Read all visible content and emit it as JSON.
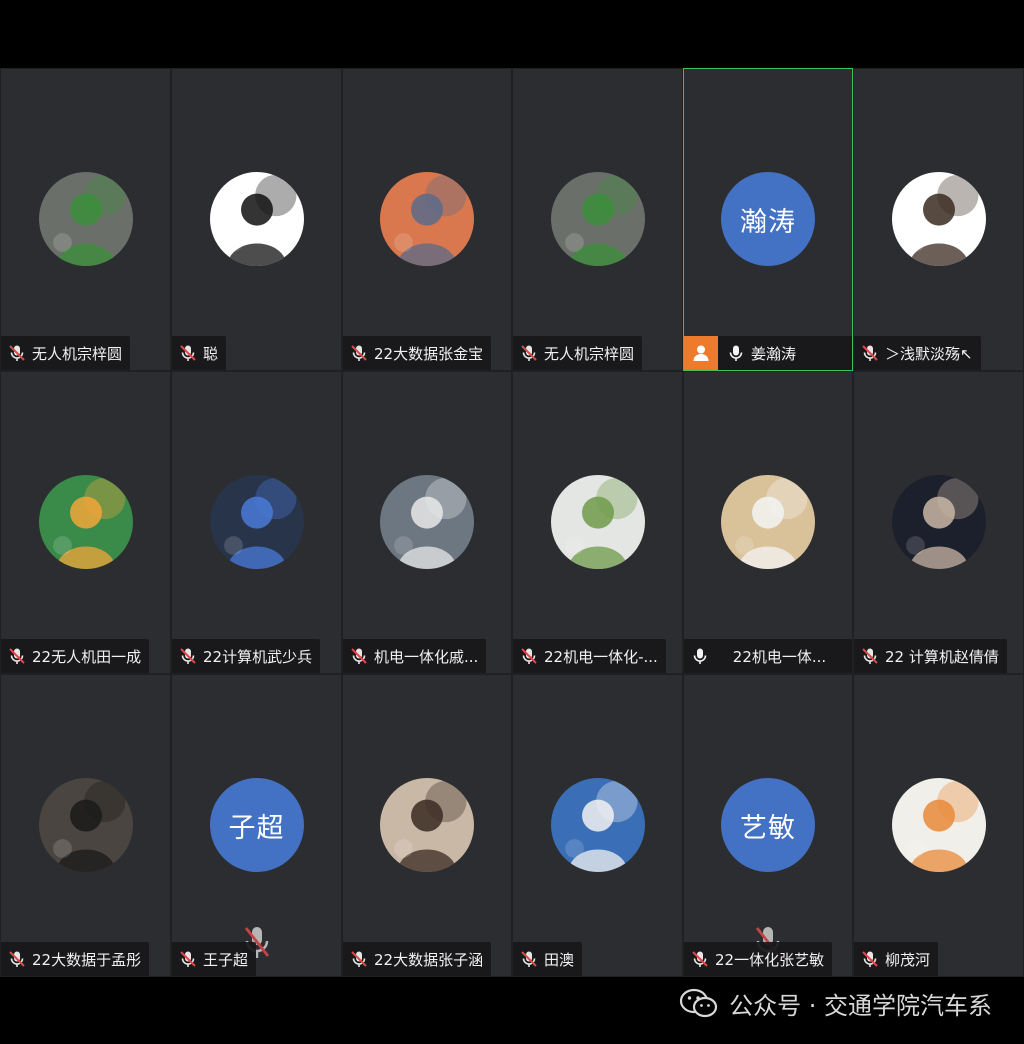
{
  "participants": [
    {
      "name": "无人机宗梓圆",
      "mic": "muted",
      "avatar": {
        "type": "image",
        "icon": "woman-photo-avatar",
        "bg": "#6b6f6a",
        "accent": "#3b8f3a"
      }
    },
    {
      "name": "聪",
      "mic": "muted",
      "avatar": {
        "type": "image",
        "icon": "sketch-avatar",
        "bg": "#ffffff",
        "accent": "#111111"
      }
    },
    {
      "name": "22大数据张金宝",
      "mic": "muted",
      "avatar": {
        "type": "image",
        "icon": "sunset-anime-avatar",
        "bg": "#d9784e",
        "accent": "#5a6a8a"
      }
    },
    {
      "name": "无人机宗梓圆",
      "mic": "muted",
      "avatar": {
        "type": "image",
        "icon": "woman-photo-avatar",
        "bg": "#6b6f6a",
        "accent": "#3b8f3a"
      }
    },
    {
      "name": "姜瀚涛",
      "mic": "on",
      "host": true,
      "active": true,
      "avatar": {
        "type": "text",
        "text": "瀚涛"
      }
    },
    {
      "name": "＞浅默淡殇↖",
      "mic": "muted",
      "avatar": {
        "type": "image",
        "icon": "cartoon-boy-avatar",
        "bg": "#ffffff",
        "accent": "#3a2a20"
      }
    },
    {
      "name": "22无人机田一成",
      "mic": "muted",
      "avatar": {
        "type": "image",
        "icon": "cartoon-robot-avatar",
        "bg": "#3a8a4a",
        "accent": "#f2a63a"
      }
    },
    {
      "name": "22计算机武少兵",
      "mic": "muted",
      "avatar": {
        "type": "image",
        "icon": "stitch-avatar",
        "bg": "#27344a",
        "accent": "#4a7ad8"
      }
    },
    {
      "name": "机电一体化戚...",
      "mic": "muted",
      "avatar": {
        "type": "image",
        "icon": "wave-art-avatar",
        "bg": "#6d7782",
        "accent": "#e8e8e8"
      }
    },
    {
      "name": "22机电一体化-...",
      "mic": "muted",
      "avatar": {
        "type": "image",
        "icon": "flower-photo-avatar",
        "bg": "#e4e6e3",
        "accent": "#6f9a4a"
      }
    },
    {
      "name": "22机电一体...",
      "mic": "on",
      "avatar": {
        "type": "image",
        "icon": "car-photo-avatar",
        "bg": "#d9c29a",
        "accent": "#f3f3f3"
      }
    },
    {
      "name": "22 计算机赵倩倩",
      "mic": "muted",
      "avatar": {
        "type": "image",
        "icon": "anime-girl-avatar",
        "bg": "#1c1f2c",
        "accent": "#c9b7a6"
      }
    },
    {
      "name": "22大数据于孟彤",
      "mic": "muted",
      "avatar": {
        "type": "image",
        "icon": "dark-photo-avatar",
        "bg": "#4a4540",
        "accent": "#1a1a1a"
      }
    },
    {
      "name": "王子超",
      "mic": "muted",
      "float_mic": true,
      "avatar": {
        "type": "text",
        "text": "子超"
      }
    },
    {
      "name": "22大数据张子涵",
      "mic": "muted",
      "avatar": {
        "type": "image",
        "icon": "anime-boy-avatar",
        "bg": "#c9b8a6",
        "accent": "#3a2a22"
      }
    },
    {
      "name": "田澳",
      "mic": "muted",
      "avatar": {
        "type": "image",
        "icon": "racing-helmet-avatar",
        "bg": "#3a6fb8",
        "accent": "#f2f2f2"
      }
    },
    {
      "name": "22一体化张艺敏",
      "mic": "muted",
      "float_mic": true,
      "avatar": {
        "type": "text",
        "text": "艺敏"
      }
    },
    {
      "name": "柳茂河",
      "mic": "muted",
      "avatar": {
        "type": "image",
        "icon": "duck-toy-avatar",
        "bg": "#f1efe9",
        "accent": "#e88a3a"
      }
    }
  ],
  "watermark": {
    "text": "公众号 · 交通学院汽车系",
    "icon": "wechat-icon"
  },
  "colors": {
    "tile": "#2c2d30",
    "active_border": "#3fbf5a",
    "host_badge": "#ee7a2c",
    "text_avatar": "#4372c4",
    "muted_mic": "#e04848"
  }
}
